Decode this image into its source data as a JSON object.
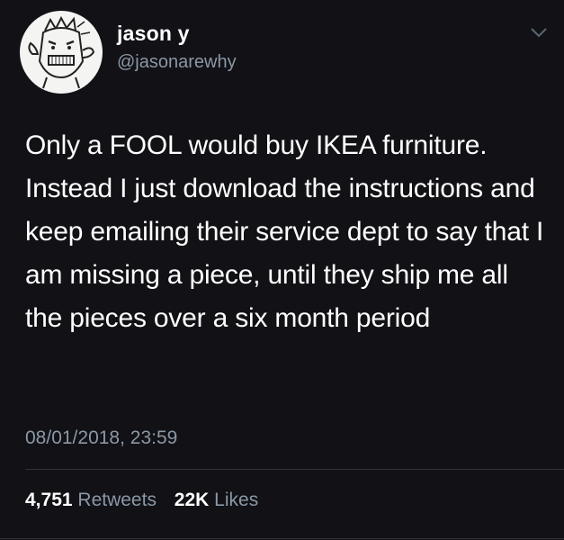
{
  "user": {
    "display_name": "jason y",
    "handle": "@jasonarewhy"
  },
  "tweet": {
    "text": "Only a FOOL would buy IKEA furniture. Instead I just download the instructions and keep emailing their service dept to say that I am missing a piece, until they ship me all the pieces over a six month period",
    "timestamp": "08/01/2018, 23:59"
  },
  "stats": {
    "retweets_count": "4,751",
    "retweets_label": "Retweets",
    "likes_count": "22K",
    "likes_label": "Likes"
  },
  "icons": {
    "menu": "chevron-down-icon"
  },
  "colors": {
    "background": "#111116",
    "primary_text": "#ffffff",
    "secondary_text": "#8b98a5",
    "divider": "#2f3336"
  }
}
